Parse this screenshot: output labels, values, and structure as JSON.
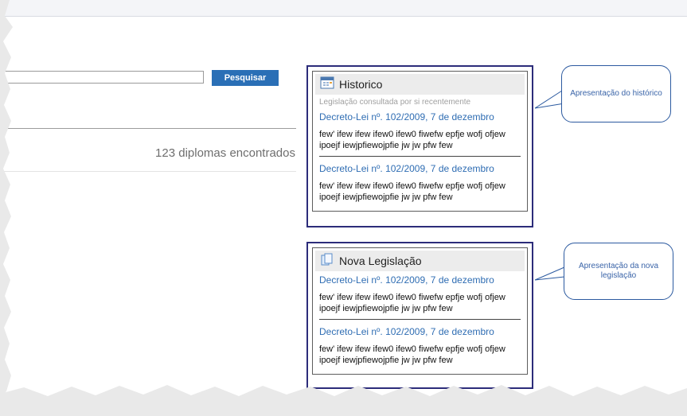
{
  "search": {
    "placeholder": "",
    "button_label": "Pesquisar"
  },
  "results": {
    "count_text": "123 diplomas encontrados"
  },
  "historico": {
    "title": "Historico",
    "subtitle": "Legislação consultada por si recentemente",
    "items": [
      {
        "link": "Decreto-Lei nº. 102/2009, 7 de dezembro",
        "text": "few' ifew ifew ifew0 ifew0 fiwefw epfje wofj ofjew ipoejf iewjpfiewojpfie jw jw pfw few"
      },
      {
        "link": "Decreto-Lei nº. 102/2009, 7 de dezembro",
        "text": "few' ifew ifew ifew0 ifew0 fiwefw epfje wofj ofjew ipoejf iewjpfiewojpfie jw jw pfw few"
      }
    ]
  },
  "nova": {
    "title": "Nova Legislação",
    "items": [
      {
        "link": "Decreto-Lei nº. 102/2009, 7 de dezembro",
        "text": "few' ifew ifew ifew0 ifew0 fiwefw epfje wofj ofjew ipoejf iewjpfiewojpfie jw jw pfw few"
      },
      {
        "link": "Decreto-Lei nº. 102/2009, 7 de dezembro",
        "text": "few' ifew ifew ifew0 ifew0 fiwefw epfje wofj ofjew ipoejf iewjpfiewojpfie jw jw pfw few"
      }
    ]
  },
  "callouts": {
    "historico": "Apresentação do histórico",
    "nova": "Apresentação da nova legislação"
  },
  "icons": {
    "historico": "calendar-icon",
    "nova": "document-icon"
  },
  "colors": {
    "accent": "#2a6fb6",
    "link": "#2f6db3",
    "panel_border": "#2c2c7a",
    "callout_border": "#2c5aa0"
  }
}
